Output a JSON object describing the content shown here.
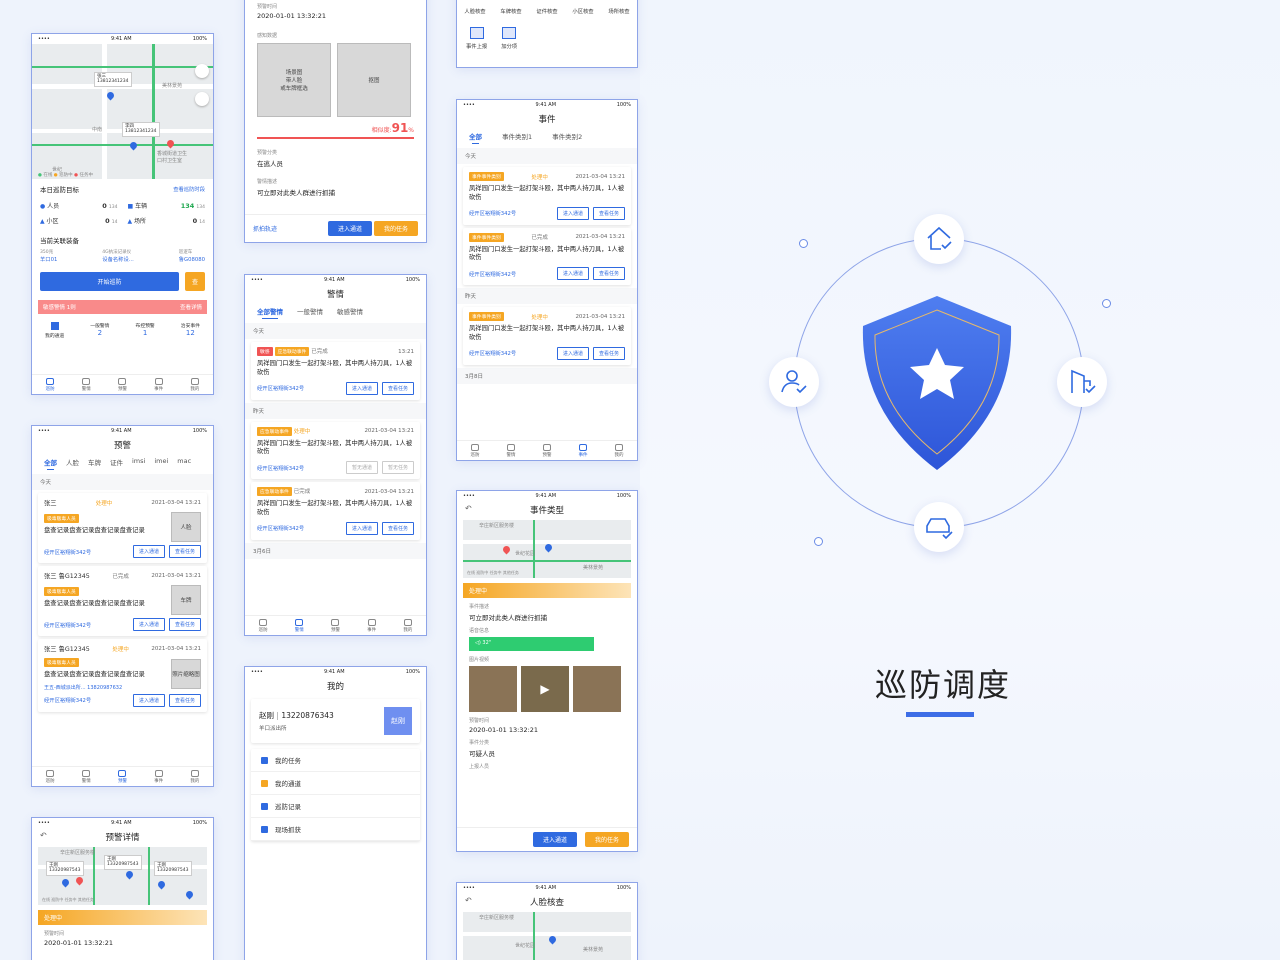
{
  "brand": {
    "title": "巡防调度",
    "accent": "#3d6de6"
  },
  "status": {
    "time": "9:41 AM",
    "battery": "100%"
  },
  "phone1": {
    "map": {
      "labels": [
        "张三",
        "13812341234",
        "中南",
        "李四",
        "13812341234",
        "谷城",
        "中南·世",
        "香城街道卫生",
        "口村卫生室",
        "巴台",
        "世纪",
        "美林景苑",
        "地图资源",
        "消息"
      ],
      "legend": [
        "在线",
        "巡防中",
        "任务中"
      ]
    },
    "target_title": "本日巡防目标",
    "view_link": "查看巡防时段",
    "stats": [
      {
        "name": "人员",
        "val": "0",
        "tot": "134"
      },
      {
        "name": "车辆",
        "val": "134",
        "tot": "134"
      },
      {
        "name": "小区",
        "val": "0",
        "tot": "14"
      },
      {
        "name": "场所",
        "val": "0",
        "tot": "14"
      }
    ],
    "equip_title": "当前关联装备",
    "equip": [
      {
        "k": "350兆",
        "v": "羊口01"
      },
      {
        "k": "4G执法记录仪",
        "v": "设备名称设..."
      },
      {
        "k": "巡逻车",
        "v": "鲁G08080"
      }
    ],
    "start": "开始巡防",
    "check": "查",
    "alert": "敏感警情 1则",
    "alert_link": "查看详情",
    "mini": [
      {
        "k": "我的通道",
        "v": ""
      },
      {
        "k": "一般警情",
        "v": "2"
      },
      {
        "k": "布控预警",
        "v": "1"
      },
      {
        "k": "治安事件",
        "v": "12"
      }
    ],
    "nav": [
      "巡防",
      "警情",
      "预警",
      "事件",
      "我的"
    ]
  },
  "phone2": {
    "title": "预警",
    "tabs": [
      "全部",
      "人脸",
      "车牌",
      "证件",
      "imsi",
      "imei",
      "mac"
    ],
    "section": "今天",
    "cards": [
      {
        "name": "张三",
        "status": "处理中",
        "time": "2021-03-04 13:21",
        "tag": "吸毒贩毒人员",
        "text": "盘查记录盘查记录盘查记录盘查记录",
        "img": "人脸",
        "addr": "经开区裕翔街342号",
        "b1": "进入通道",
        "b2": "查看任务",
        "extra": ""
      },
      {
        "name": "张三  鲁G12345",
        "status": "已完成",
        "time": "2021-03-04 13:21",
        "tag": "吸毒贩毒人员",
        "text": "盘查记录盘查记录盘查记录盘查记录",
        "img": "车牌",
        "addr": "经开区裕翔街342号",
        "b1": "进入通道",
        "b2": "查看任务",
        "extra": ""
      },
      {
        "name": "张三  鲁G12345",
        "status": "处理中",
        "time": "2021-03-04 13:21",
        "tag": "吸毒贩毒人员",
        "text": "盘查记录盘查记录盘查记录盘查记录",
        "img": "照片缩略图",
        "addr": "经开区裕翔街342号",
        "b1": "进入通道",
        "b2": "查看任务",
        "extra": "王五-西城派出所...    13820987632"
      }
    ]
  },
  "phone3": {
    "title": "预警详情",
    "status": "处理中",
    "lab": "预警时间",
    "time": "2020-01-01  13:32:21",
    "map": [
      "辛庄新区服务楼",
      "王刚",
      "13320987543",
      "王刚",
      "13320987543",
      "王刚",
      "13320987543"
    ],
    "legend": [
      "在线",
      "巡防中",
      "任务中",
      "其他任务"
    ]
  },
  "phone4": {
    "lab1": "预警时间",
    "time": "2020-01-01  13:32:21",
    "lab2": "感知数据",
    "img1": "场景图\n带人脸\n或车牌框选",
    "img2": "抠图",
    "sim_label": "相似度:",
    "sim": "91",
    "pct": "%",
    "lab3": "预警分类",
    "cls": "在逃人员",
    "lab4": "警情描述",
    "desc": "可立即对此类人群进行抓捕",
    "track": "抓拍轨迹",
    "b1": "进入通道",
    "b2": "我的任务"
  },
  "phone5": {
    "title": "警情",
    "tabs": [
      "全部警情",
      "一般警情",
      "敏感警情"
    ],
    "s1": "今天",
    "s2": "昨天",
    "s3": "3月6日",
    "cards": [
      {
        "tags": [
          "敏感",
          "应急联动事件"
        ],
        "status": "已完成",
        "time": "13:21",
        "text": "凤祥园门口发生一起打架斗殴，其中两人持刀具，1人被砍伤",
        "addr": "经开区裕翔街342号",
        "b1": "进入通道",
        "b2": "查看任务",
        "dis": false
      },
      {
        "tags": [
          "应急联动事件"
        ],
        "status": "处理中",
        "time": "2021-03-04 13:21",
        "text": "凤祥园门口发生一起打架斗殴，其中两人持刀具，1人被砍伤",
        "addr": "经开区裕翔街342号",
        "b1": "暂无通道",
        "b2": "暂无任务",
        "dis": true
      },
      {
        "tags": [
          "应急联动事件"
        ],
        "status": "已完成",
        "time": "2021-03-04 13:21",
        "text": "凤祥园门口发生一起打架斗殴，其中两人持刀具，1人被砍伤",
        "addr": "经开区裕翔街342号",
        "b1": "进入通道",
        "b2": "查看任务",
        "dis": false
      }
    ]
  },
  "phone6": {
    "title": "我的",
    "name": "赵刚",
    "phone": "13220876343",
    "org": "羊口派出所",
    "avatar": "赵刚",
    "items": [
      "我的任务",
      "我的通道",
      "巡防记录",
      "现场抓获"
    ]
  },
  "phone7": {
    "row1": [
      "人脸核查",
      "车牌核查",
      "证件核查",
      "小区核查",
      "场所核查"
    ],
    "row2": [
      "事件上报",
      "加分项"
    ]
  },
  "phone8": {
    "title": "事件",
    "tabs": [
      "全部",
      "事件类别1",
      "事件类别2"
    ],
    "s1": "今天",
    "s2": "昨天",
    "s3": "3月8日",
    "cards": [
      {
        "tag": "事件事件类别",
        "status": "处理中",
        "time": "2021-03-04 13:21",
        "text": "凤祥园门口发生一起打架斗殴，其中两人持刀具，1人被砍伤",
        "addr": "经开区裕翔街342号",
        "b1": "进入通道",
        "b2": "查看任务"
      },
      {
        "tag": "事件事件类别",
        "status": "已完成",
        "time": "2021-03-04 13:21",
        "text": "凤祥园门口发生一起打架斗殴，其中两人持刀具，1人被砍伤",
        "addr": "经开区裕翔街342号",
        "b1": "进入通道",
        "b2": "查看任务"
      },
      {
        "tag": "事件事件类别",
        "status": "处理中",
        "time": "2021-03-04 13:21",
        "text": "凤祥园门口发生一起打架斗殴，其中两人持刀具，1人被砍伤",
        "addr": "经开区裕翔街342号",
        "b1": "进入通道",
        "b2": "查看任务"
      }
    ]
  },
  "phone9": {
    "title": "事件类型",
    "map": [
      "辛庄新区服务楼",
      "世纪花园",
      "美林景苑"
    ],
    "legend": [
      "在线",
      "巡防中",
      "任务中",
      "其他任务"
    ],
    "status": "处理中",
    "lab1": "事件描述",
    "desc": "可立即对此类人群进行抓捕",
    "lab2": "语音信息",
    "voice": "32\"",
    "lab3": "图片视频",
    "lab4": "预警时间",
    "time": "2020-01-01  13:32:21",
    "lab5": "事件分类",
    "cls": "可疑人员",
    "lab6": "上报人员",
    "b1": "进入通道",
    "b2": "我的任务"
  },
  "phone10": {
    "title": "人脸核查",
    "map": [
      "辛庄新区服务楼",
      "世纪花园",
      "美林景苑"
    ]
  }
}
